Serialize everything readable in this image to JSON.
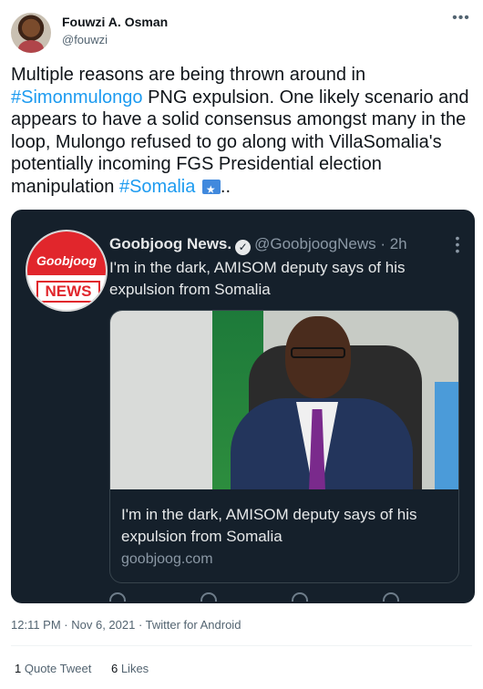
{
  "author": {
    "name": "Fouwzi A. Osman",
    "handle": "@fouwzi"
  },
  "tweet": {
    "line1": "Multiple reasons are being thrown around in",
    "hashtag1": "#Simonmulongo",
    "line2": " PNG expulsion. One likely scenario and appears to have a solid consensus amongst many in the loop, Mulongo refused to go along with VillaSomalia's potentially incoming FGS Presidential election manipulation ",
    "hashtag2": "#Somalia",
    "ending": ".."
  },
  "quoted": {
    "logo_top": "Goobjoog",
    "logo_bottom": "NEWS",
    "name": "Goobjoog News.",
    "handle": "@GoobjoogNews",
    "time": "· 2h",
    "text": "I'm in the dark, AMISOM deputy says of his expulsion from Somalia",
    "link_title": "I'm in the dark, AMISOM deputy says of his expulsion from Somalia",
    "link_domain": "goobjoog.com"
  },
  "meta": {
    "time": "12:11 PM · Nov 6, 2021 · Twitter for Android"
  },
  "stats": {
    "quote_count": "1",
    "quote_label": "Quote Tweet",
    "like_count": "6",
    "like_label": "Likes"
  },
  "colors": {
    "accent": "#1d9bf0",
    "card_bg": "#15202b"
  },
  "icons": [
    "more-icon",
    "verified-badge-icon",
    "somalia-flag-icon",
    "reply-icon",
    "retweet-icon",
    "like-icon",
    "share-icon"
  ]
}
